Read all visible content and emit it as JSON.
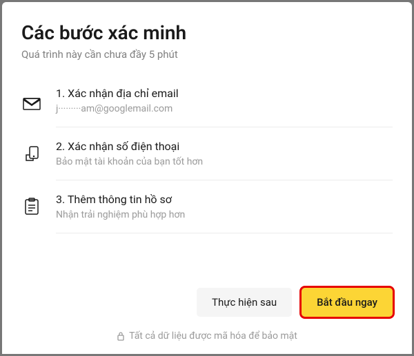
{
  "title": "Các bước xác minh",
  "subtitle": "Quá trình này cần chưa đầy 5 phút",
  "steps": [
    {
      "title": "1. Xác nhận địa chỉ email",
      "desc": "j·········am@googlemail.com"
    },
    {
      "title": "2. Xác nhận số điện thoại",
      "desc": "Bảo mật tài khoản của bạn tốt hơn"
    },
    {
      "title": "3. Thêm thông tin hồ sơ",
      "desc": "Nhận trải nghiệm phù hợp hơn"
    }
  ],
  "buttons": {
    "later": "Thực hiện sau",
    "start": "Bắt đầu ngay"
  },
  "security_note": "Tất cả dữ liệu được mã hóa để bảo mật"
}
